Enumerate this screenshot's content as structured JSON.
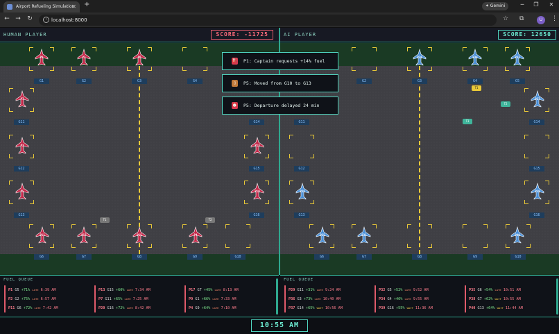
{
  "browser": {
    "tab_title": "Airport Refueling Simulation",
    "url": "localhost:8000",
    "gemini_label": "Gemini",
    "avatar_letter": "U"
  },
  "human": {
    "label": "HUMAN PLAYER",
    "score": "SCORE: -11725",
    "gates_top": [
      "G1",
      "G2",
      "G3",
      "G4"
    ],
    "gates_left": [
      "G11",
      "G12",
      "G13"
    ],
    "gates_right": [
      "G14",
      "G15",
      "G16"
    ],
    "gates_bottom": [
      "G6",
      "G7",
      "G8",
      "G9",
      "G10"
    ],
    "planes": [
      {
        "id": "P8"
      },
      {
        "id": "P2"
      },
      {
        "id": "P6"
      },
      {
        "id": "P7"
      },
      {
        "id": "P3"
      },
      {
        "id": "P5"
      },
      {
        "id": "P13"
      },
      {
        "id": "P10"
      },
      {
        "id": "P11"
      },
      {
        "id": "P17"
      },
      {
        "id": "P15"
      },
      {
        "id": "P4"
      }
    ],
    "trucks": [
      "T1",
      "T2"
    ],
    "queue_title": "FUEL QUEUE",
    "queue": [
      [
        {
          "id": "P1",
          "gate": "G5",
          "fuel": "+71%",
          "status": "LATE",
          "time": "6:39 AM"
        },
        {
          "id": "P2",
          "gate": "G2",
          "fuel": "+75%",
          "status": "LATE",
          "time": "6:57 AM"
        },
        {
          "id": "P11",
          "gate": "G6",
          "fuel": "+72%",
          "status": "LATE",
          "time": "7:42 AM"
        }
      ],
      [
        {
          "id": "P13",
          "gate": "G15",
          "fuel": "+60%",
          "status": "LATE",
          "time": "7:34 AM"
        },
        {
          "id": "P7",
          "gate": "G11",
          "fuel": "+65%",
          "status": "LATE",
          "time": "7:25 AM"
        },
        {
          "id": "P20",
          "gate": "G16",
          "fuel": "+72%",
          "status": "LATE",
          "time": "8:42 AM"
        }
      ],
      [
        {
          "id": "P17",
          "gate": "G7",
          "fuel": "+45%",
          "status": "LATE",
          "time": "8:13 AM"
        },
        {
          "id": "P9",
          "gate": "G1",
          "fuel": "+66%",
          "status": "LATE",
          "time": "7:33 AM"
        },
        {
          "id": "P4",
          "gate": "G9",
          "fuel": "+64%",
          "status": "LATE",
          "time": "7:10 AM"
        }
      ]
    ]
  },
  "ai": {
    "label": "AI PLAYER",
    "score": "SCORE: 12650",
    "gates_top": [
      "G2",
      "G3",
      "G4",
      "G5"
    ],
    "gates_left": [
      "G11",
      "G12",
      "G13"
    ],
    "gates_right": [
      "G14",
      "G15",
      "G16"
    ],
    "gates_bottom": [
      "G6",
      "G7",
      "G8",
      "G9",
      "G10"
    ],
    "planes": [
      {
        "id": "P36"
      },
      {
        "id": "P34"
      },
      {
        "id": "P32"
      },
      {
        "id": "P37"
      },
      {
        "id": "P38"
      },
      {
        "id": "P39"
      },
      {
        "id": "P35"
      },
      {
        "id": "P31"
      },
      {
        "id": "P40"
      }
    ],
    "trucks": [
      "T1",
      "T2",
      "T3"
    ],
    "queue_title": "FUEL QUEUE",
    "queue": [
      [
        {
          "id": "P29",
          "gate": "G11",
          "fuel": "+31%",
          "status": "LATE",
          "time": "9:24 AM"
        },
        {
          "id": "P36",
          "gate": "G3",
          "fuel": "+73%",
          "status": "LATE",
          "time": "10:40 AM"
        },
        {
          "id": "P37",
          "gate": "G14",
          "fuel": "+65%",
          "status": "WAIT",
          "time": "10:56 AM"
        }
      ],
      [
        {
          "id": "P32",
          "gate": "G5",
          "fuel": "+52%",
          "status": "LATE",
          "time": "9:52 AM"
        },
        {
          "id": "P34",
          "gate": "G4",
          "fuel": "+46%",
          "status": "LATE",
          "time": "9:55 AM"
        },
        {
          "id": "P39",
          "gate": "G16",
          "fuel": "+55%",
          "status": "WAIT",
          "time": "11:36 AM"
        }
      ],
      [
        {
          "id": "P35",
          "gate": "G6",
          "fuel": "+54%",
          "status": "LATE",
          "time": "10:51 AM"
        },
        {
          "id": "P38",
          "gate": "G7",
          "fuel": "+62%",
          "status": "WAIT",
          "time": "10:55 AM"
        },
        {
          "id": "P40",
          "gate": "G13",
          "fuel": "+64%",
          "status": "WAIT",
          "time": "11:44 AM"
        }
      ]
    ]
  },
  "notifications": [
    {
      "text": "P1: Captain requests +14% fuel",
      "icon": "fuel-pump-icon"
    },
    {
      "text": "P5: Moved from G10 to G13",
      "icon": "door-icon"
    },
    {
      "text": "P5: Departure delayed 24 min",
      "icon": "alarm-clock-icon"
    }
  ],
  "clock": "10:55 AM",
  "colors": {
    "human_plane": "#c4294a",
    "ai_plane": "#4a8fd6",
    "accent": "#2fa88f",
    "taxi_line": "#e8c838"
  }
}
